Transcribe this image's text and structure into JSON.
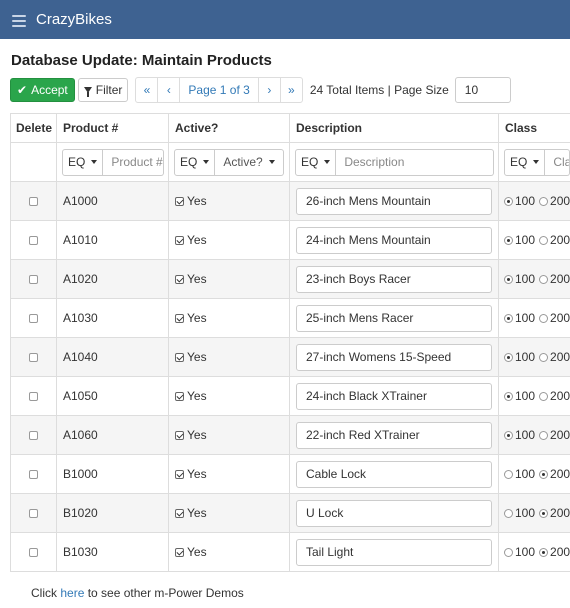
{
  "navbar": {
    "brand": "CrazyBikes",
    "menu_icon": "hamburger-icon"
  },
  "page": {
    "title": "Database Update: Maintain Products"
  },
  "toolbar": {
    "accept_label": "Accept",
    "filter_label": "Filter",
    "pager": {
      "first": "«",
      "prev": "‹",
      "page_label": "Page 1 of 3",
      "next": "›",
      "last": "»"
    },
    "total_label": "24 Total Items | Page Size",
    "page_size": "10"
  },
  "table": {
    "columns": [
      "Delete",
      "Product #",
      "Active?",
      "Description",
      "Class"
    ],
    "filters": {
      "product": {
        "op": "EQ",
        "placeholder": "Product #"
      },
      "active": {
        "op": "EQ",
        "value": "Active?"
      },
      "description": {
        "op": "EQ",
        "placeholder": "Description"
      },
      "class": {
        "op": "EQ",
        "placeholder": "Class"
      }
    },
    "class_options": [
      "100",
      "200"
    ],
    "rows": [
      {
        "product": "A1000",
        "active": "Yes",
        "description": "26-inch Mens Mountain",
        "class": "100"
      },
      {
        "product": "A1010",
        "active": "Yes",
        "description": "24-inch Mens Mountain",
        "class": "100"
      },
      {
        "product": "A1020",
        "active": "Yes",
        "description": "23-inch Boys Racer",
        "class": "100"
      },
      {
        "product": "A1030",
        "active": "Yes",
        "description": "25-inch Mens Racer",
        "class": "100"
      },
      {
        "product": "A1040",
        "active": "Yes",
        "description": "27-inch Womens 15-Speed",
        "class": "100"
      },
      {
        "product": "A1050",
        "active": "Yes",
        "description": "24-inch Black XTrainer",
        "class": "100"
      },
      {
        "product": "A1060",
        "active": "Yes",
        "description": "22-inch Red XTrainer",
        "class": "100"
      },
      {
        "product": "B1000",
        "active": "Yes",
        "description": "Cable Lock",
        "class": "200"
      },
      {
        "product": "B1020",
        "active": "Yes",
        "description": "U Lock",
        "class": "200"
      },
      {
        "product": "B1030",
        "active": "Yes",
        "description": "Tail Light",
        "class": "200"
      }
    ]
  },
  "footer": {
    "prefix": "Click ",
    "link": "here",
    "suffix": " to see other m-Power Demos"
  }
}
